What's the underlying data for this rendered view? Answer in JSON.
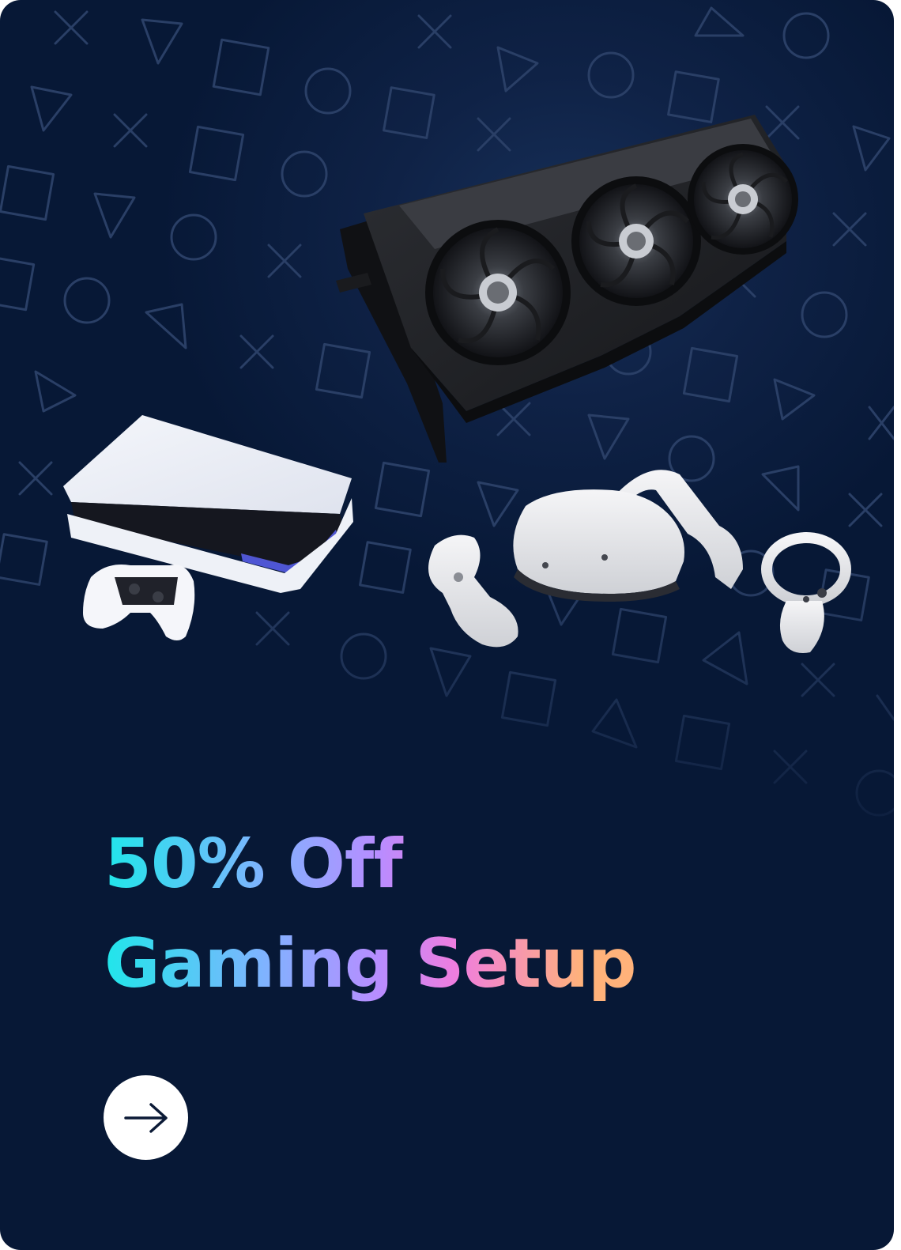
{
  "promo": {
    "headline_line1": "50% Off",
    "headline_line2": "Gaming Setup"
  },
  "cta": {
    "icon": "arrow-right-icon"
  },
  "images": {
    "gpu": "graphics-card",
    "console": "game-console-with-controller",
    "vr": "vr-headset-with-controllers"
  },
  "colors": {
    "background": "#071836",
    "pattern": "#2a3f66",
    "gradient": [
      "#20e6ea",
      "#7fb3ff",
      "#b98cff",
      "#ef7ddf",
      "#ffb27a"
    ],
    "button": "#ffffff",
    "arrow": "#0b1a36"
  }
}
